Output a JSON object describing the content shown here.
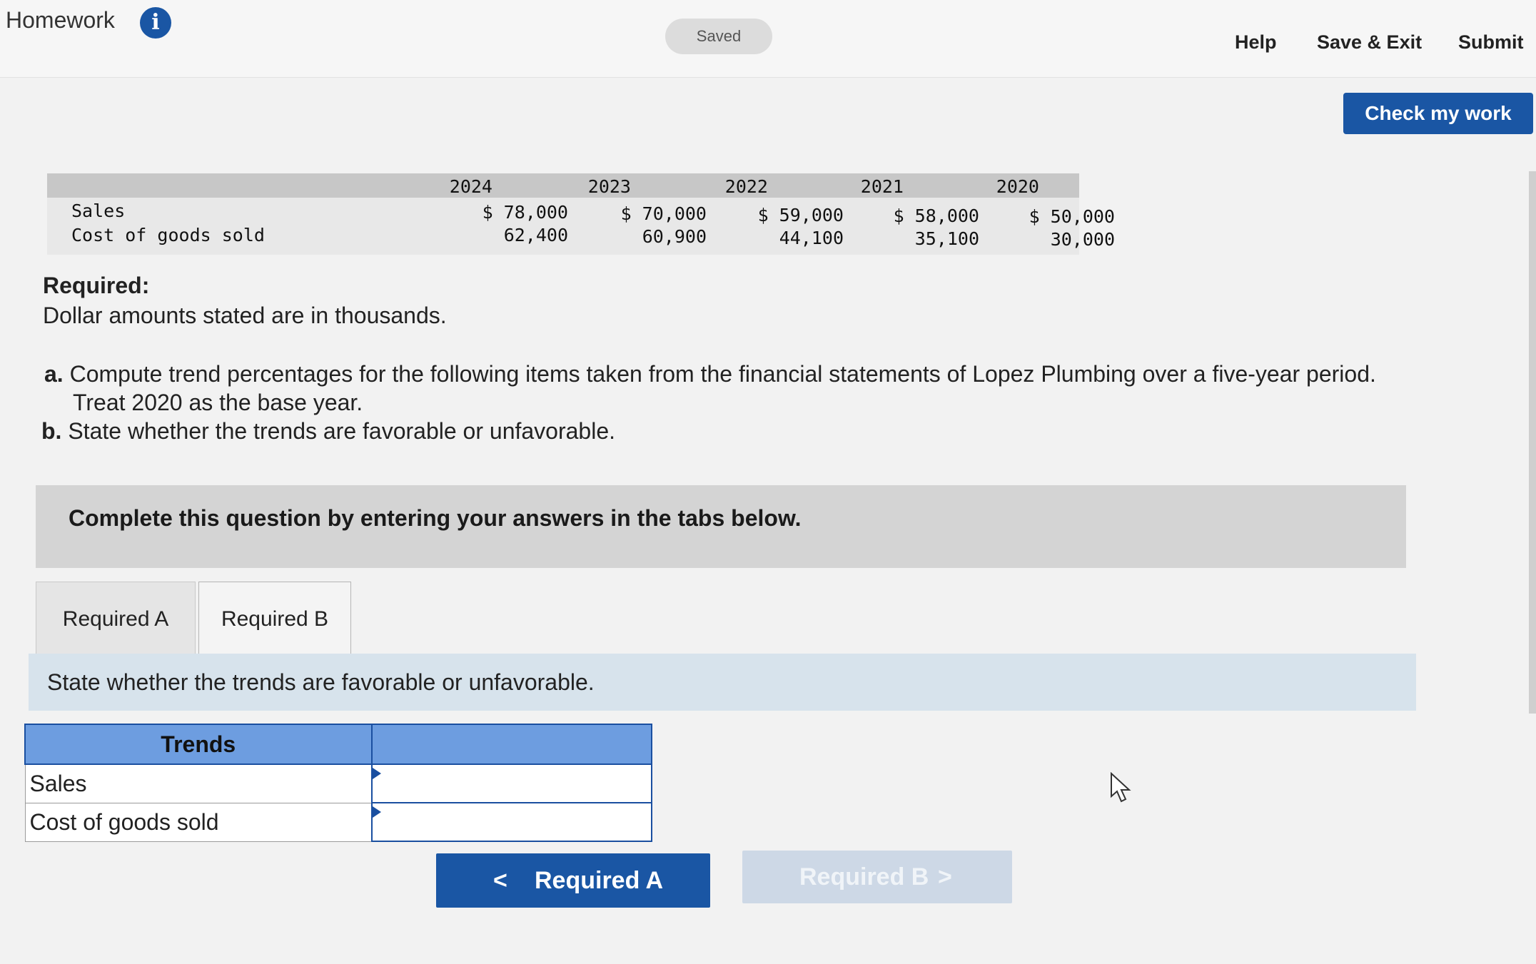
{
  "header": {
    "title": "Homework",
    "info_icon": "i",
    "saved_status": "Saved",
    "help_label": "Help",
    "save_exit_label": "Save & Exit",
    "submit_label": "Submit",
    "check_work_label": "Check my work"
  },
  "data_table": {
    "years": [
      "2024",
      "2023",
      "2022",
      "2021",
      "2020"
    ],
    "rows": [
      {
        "label": "Sales",
        "values": [
          "$ 78,000",
          "$ 70,000",
          "$ 59,000",
          "$ 58,000",
          "$ 50,000"
        ]
      },
      {
        "label": "Cost of goods sold",
        "values": [
          "62,400",
          "60,900",
          "44,100",
          "35,100",
          "30,000"
        ]
      }
    ]
  },
  "required": {
    "title": "Required:",
    "note": "Dollar amounts stated are in thousands.",
    "items": [
      {
        "letter": "a.",
        "text": "Compute trend percentages for the following items taken from the financial statements of Lopez Plumbing over a five-year period.",
        "continuation": "Treat 2020 as the base year."
      },
      {
        "letter": "b.",
        "text": "State whether the trends are favorable or unfavorable."
      }
    ]
  },
  "banner": {
    "text": "Complete this question by entering your answers in the tabs below."
  },
  "tabs": [
    {
      "label": "Required A"
    },
    {
      "label": "Required B"
    }
  ],
  "instruction": "State whether the trends are favorable or unfavorable.",
  "trends_table": {
    "header": "Trends",
    "rows": [
      {
        "label": "Sales",
        "value": ""
      },
      {
        "label": "Cost of goods sold",
        "value": ""
      }
    ]
  },
  "nav": {
    "prev_label": "Required A",
    "next_label": "Required B",
    "prev_chevron": "<",
    "next_chevron": ">"
  }
}
